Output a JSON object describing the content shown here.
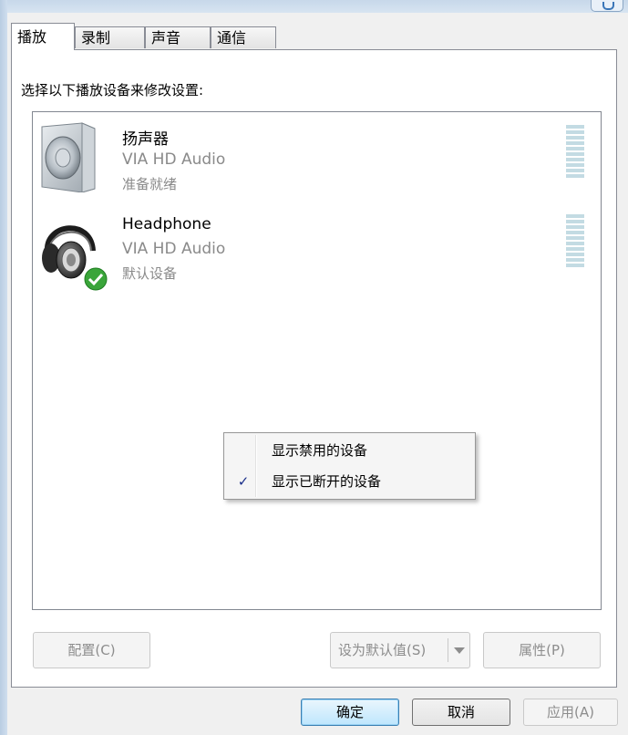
{
  "tabs": [
    {
      "label": "播放",
      "active": true
    },
    {
      "label": "录制",
      "active": false
    },
    {
      "label": "声音",
      "active": false
    },
    {
      "label": "通信",
      "active": false
    }
  ],
  "instruction": "选择以下播放设备来修改设置:",
  "devices": [
    {
      "name": "扬声器",
      "driver": "VIA HD Audio",
      "status": "准备就绪",
      "icon": "speaker-icon"
    },
    {
      "name": "Headphone",
      "driver": "VIA HD Audio",
      "status": "默认设备",
      "icon": "headphone-icon",
      "default_badge": "default-check-icon"
    }
  ],
  "context_menu": {
    "items": [
      {
        "label": "显示禁用的设备",
        "checked": false
      },
      {
        "label": "显示已断开的设备",
        "checked": true
      }
    ],
    "check_glyph": "✓"
  },
  "buttons": {
    "configure": "配置(C)",
    "set_default": "设为默认值(S)",
    "properties": "属性(P)",
    "ok": "确定",
    "cancel": "取消",
    "apply": "应用(A)"
  },
  "colors": {
    "meter": "#c3dbe3",
    "default_badge": "#3aa53a",
    "check": "#1a2f8a"
  }
}
